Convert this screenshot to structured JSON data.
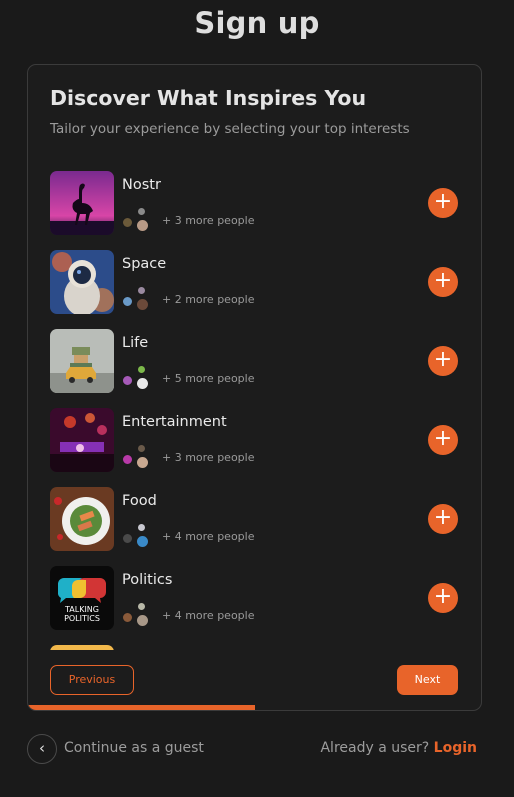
{
  "page": {
    "title": "Sign up"
  },
  "card": {
    "title": "Discover What Inspires You",
    "subtitle": "Tailor your experience by selecting your top interests"
  },
  "interests": [
    {
      "name": "Nostr",
      "more": "+ 3 more people",
      "icon": "ostrich-silhouette"
    },
    {
      "name": "Space",
      "more": "+ 2 more people",
      "icon": "astronaut"
    },
    {
      "name": "Life",
      "more": "+ 5 more people",
      "icon": "stacked-car-toy"
    },
    {
      "name": "Entertainment",
      "more": "+ 3 more people",
      "icon": "concert-crowd"
    },
    {
      "name": "Food",
      "more": "+ 4 more people",
      "icon": "salad-plate"
    },
    {
      "name": "Politics",
      "more": "+ 4 more people",
      "icon": "talking-politics-logo",
      "logo_text": [
        "TALKING",
        "POLITICS"
      ]
    }
  ],
  "buttons": {
    "previous": "Previous",
    "next": "Next",
    "add_icon": "plus-icon"
  },
  "progress": {
    "fraction": 0.5
  },
  "footer": {
    "guest_label": "Continue as a guest",
    "already": "Already a user?",
    "login": "Login"
  },
  "colors": {
    "accent": "#e8642a",
    "background": "#1a1a1a",
    "card_border": "#3b3b3b"
  }
}
